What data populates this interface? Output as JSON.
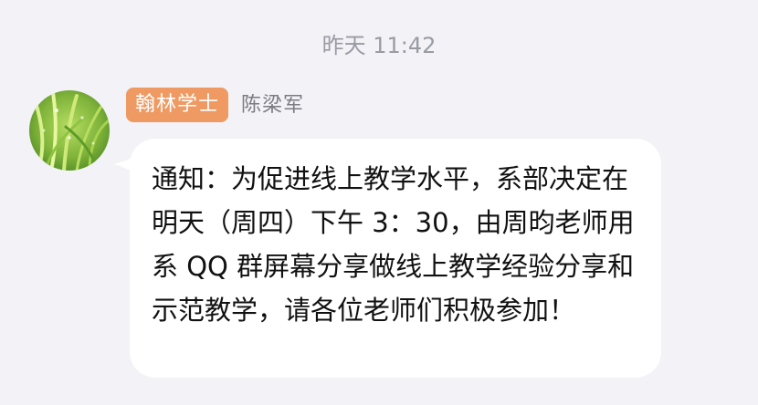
{
  "chat": {
    "timestamp": "昨天 11:42",
    "message": {
      "sender_badge": "翰林学士",
      "sender_name": "陈梁军",
      "avatar_icon": "rice-seedling-avatar",
      "text": "通知：为促进线上教学水平，系部决定在明天（周四）下午 3：30，由周昀老师用系 QQ 群屏幕分享做线上教学经验分享和示范教学，请各位老师们积极参加！"
    }
  },
  "colors": {
    "background": "#f2f2f7",
    "bubble": "#ffffff",
    "badge": "#ee9a62",
    "timestamp": "#9a9aa3",
    "sender": "#7b7b82",
    "message_text": "#111111"
  }
}
